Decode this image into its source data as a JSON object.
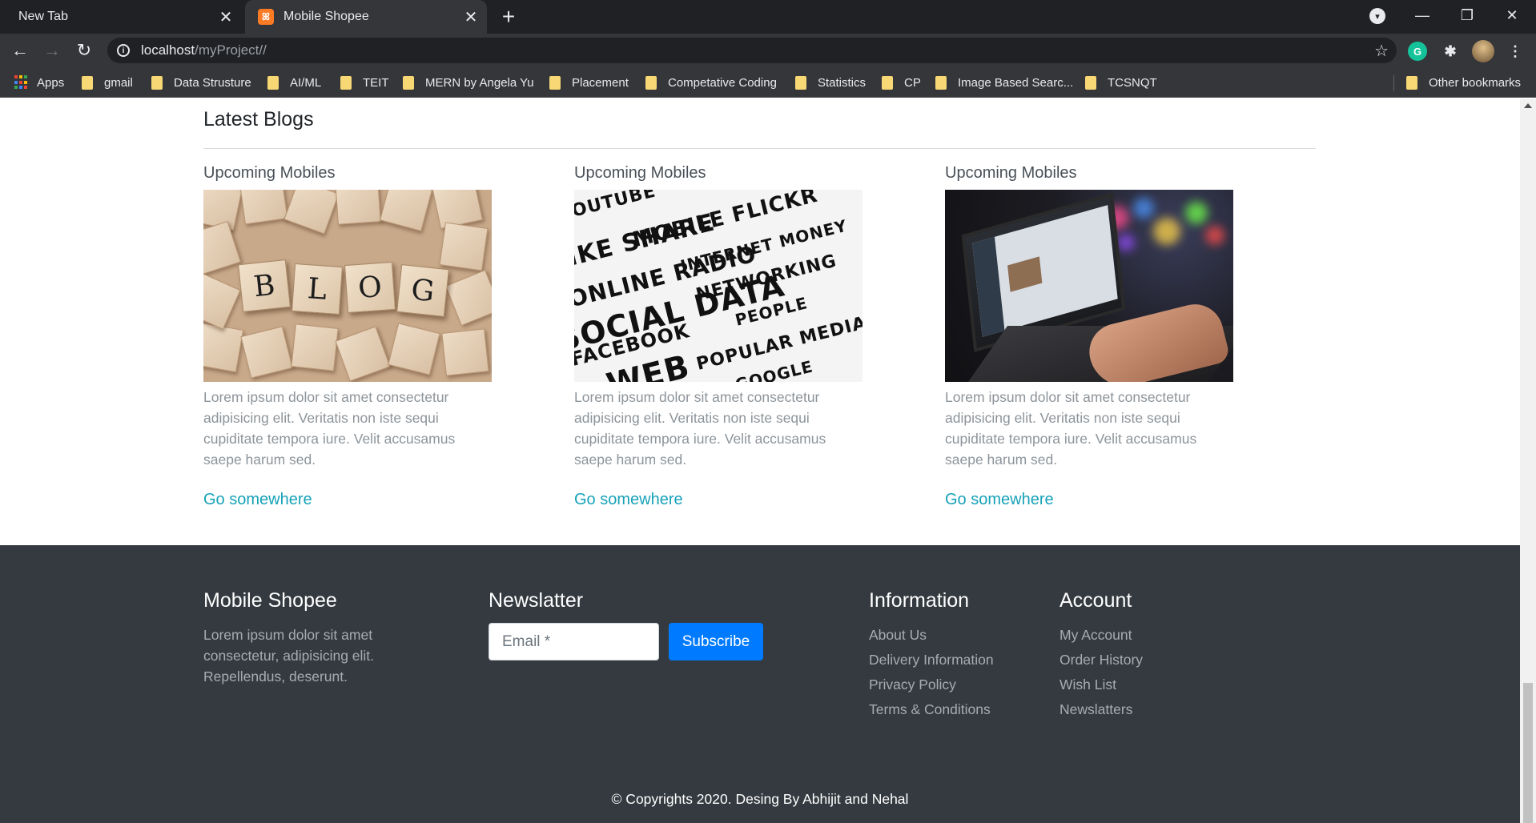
{
  "browser": {
    "tabs": [
      {
        "title": "New Tab"
      },
      {
        "title": "Mobile Shopee"
      }
    ],
    "url_host": "localhost",
    "url_path": "/myProject//",
    "bookmarks": [
      "Apps",
      "gmail",
      "Data Strusture",
      "AI/ML",
      "TEIT",
      "MERN by Angela Yu",
      "Placement",
      "Competative Coding",
      "Statistics",
      "CP",
      "Image Based Searc...",
      "TCSNQT"
    ],
    "other_bookmarks": "Other bookmarks"
  },
  "blogs": {
    "heading": "Latest Blogs",
    "cards": [
      {
        "title": "Upcoming Mobiles",
        "text": "Lorem ipsum dolor sit amet consectetur adipisicing elit. Veritatis non iste sequi cupiditate tempora iure. Velit accusamus saepe harum sed.",
        "link": "Go somewhere"
      },
      {
        "title": "Upcoming Mobiles",
        "text": "Lorem ipsum dolor sit amet consectetur adipisicing elit. Veritatis non iste sequi cupiditate tempora iure. Velit accusamus saepe harum sed.",
        "link": "Go somewhere"
      },
      {
        "title": "Upcoming Mobiles",
        "text": "Lorem ipsum dolor sit amet consectetur adipisicing elit. Veritatis non iste sequi cupiditate tempora iure. Velit accusamus saepe harum sed.",
        "link": "Go somewhere"
      }
    ],
    "blog_tiles": [
      "B",
      "L",
      "O",
      "G"
    ],
    "word_cloud": [
      "SOCIAL DATA",
      "ONLINE RADIO",
      "LIKE SHARE",
      "WEB",
      "MOBILE FLICKR",
      "FACEBOOK",
      "YOUTUBE",
      "INTERNET MONEY",
      "POPULAR MEDIA",
      "NETWORKING",
      "PEOPLE",
      "GOOGLE"
    ]
  },
  "footer": {
    "brand": "Mobile Shopee",
    "brand_text": "Lorem ipsum dolor sit amet consectetur, adipisicing elit. Repellendus, deserunt.",
    "newsletter_heading": "Newslatter",
    "email_placeholder": "Email *",
    "subscribe_label": "Subscribe",
    "information_heading": "Information",
    "information_links": [
      "About Us",
      "Delivery Information",
      "Privacy Policy",
      "Terms & Conditions"
    ],
    "account_heading": "Account",
    "account_links": [
      "My Account",
      "Order History",
      "Wish List",
      "Newslatters"
    ],
    "copyright": "© Copyrights 2020. Desing By Abhijit and Nehal"
  },
  "colors": {
    "footer_bg": "#343a40",
    "link_teal": "#17a2b8",
    "subscribe_blue": "#007bff"
  }
}
